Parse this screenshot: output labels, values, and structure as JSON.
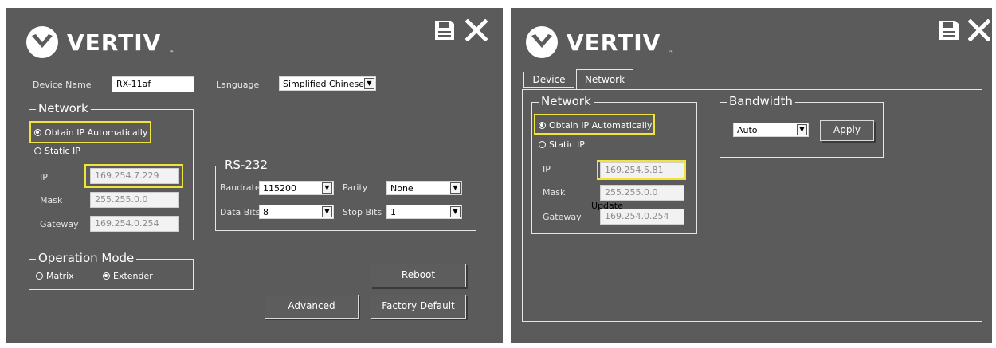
{
  "brand": "VERTIV",
  "brand_tm": "™",
  "icons": {
    "save": "save-icon",
    "close": "close-icon",
    "logo": "vertiv-chevron-logo"
  },
  "colors": {
    "panel_bg": "#5b5b5b",
    "highlight": "#f0e43a",
    "text": "#ffffff"
  },
  "left": {
    "device_name_label": "Device Name",
    "device_name_value": "RX-11af",
    "language_label": "Language",
    "language_value": "Simplified Chinese",
    "network": {
      "title": "Network",
      "obtain_auto": "Obtain IP Automatically",
      "static_ip": "Static IP",
      "ip_label": "IP",
      "ip_value": "169.254.7.229",
      "mask_label": "Mask",
      "mask_value": "255.255.0.0",
      "gateway_label": "Gateway",
      "gateway_value": "169.254.0.254"
    },
    "rs232": {
      "title": "RS-232",
      "baudrate_label": "Baudrate",
      "baudrate_value": "115200",
      "parity_label": "Parity",
      "parity_value": "None",
      "databits_label": "Data Bits",
      "databits_value": "8",
      "stopbits_label": "Stop Bits",
      "stopbits_value": "1"
    },
    "operation_mode": {
      "title": "Operation Mode",
      "matrix": "Matrix",
      "extender": "Extender"
    },
    "buttons": {
      "reboot": "Reboot",
      "advanced": "Advanced",
      "factory_default": "Factory Default"
    }
  },
  "right": {
    "tabs": [
      "Device",
      "Network"
    ],
    "network": {
      "title": "Network",
      "obtain_auto": "Obtain IP Automatically",
      "static_ip": "Static IP",
      "ip_label": "IP",
      "ip_value": "169.254.5.81",
      "mask_label": "Mask",
      "mask_value": "255.255.0.0",
      "gateway_label": "Gateway",
      "gateway_value": "169.254.0.254",
      "update_label": "Update"
    },
    "bandwidth": {
      "title": "Bandwidth",
      "value": "Auto",
      "apply": "Apply"
    }
  }
}
